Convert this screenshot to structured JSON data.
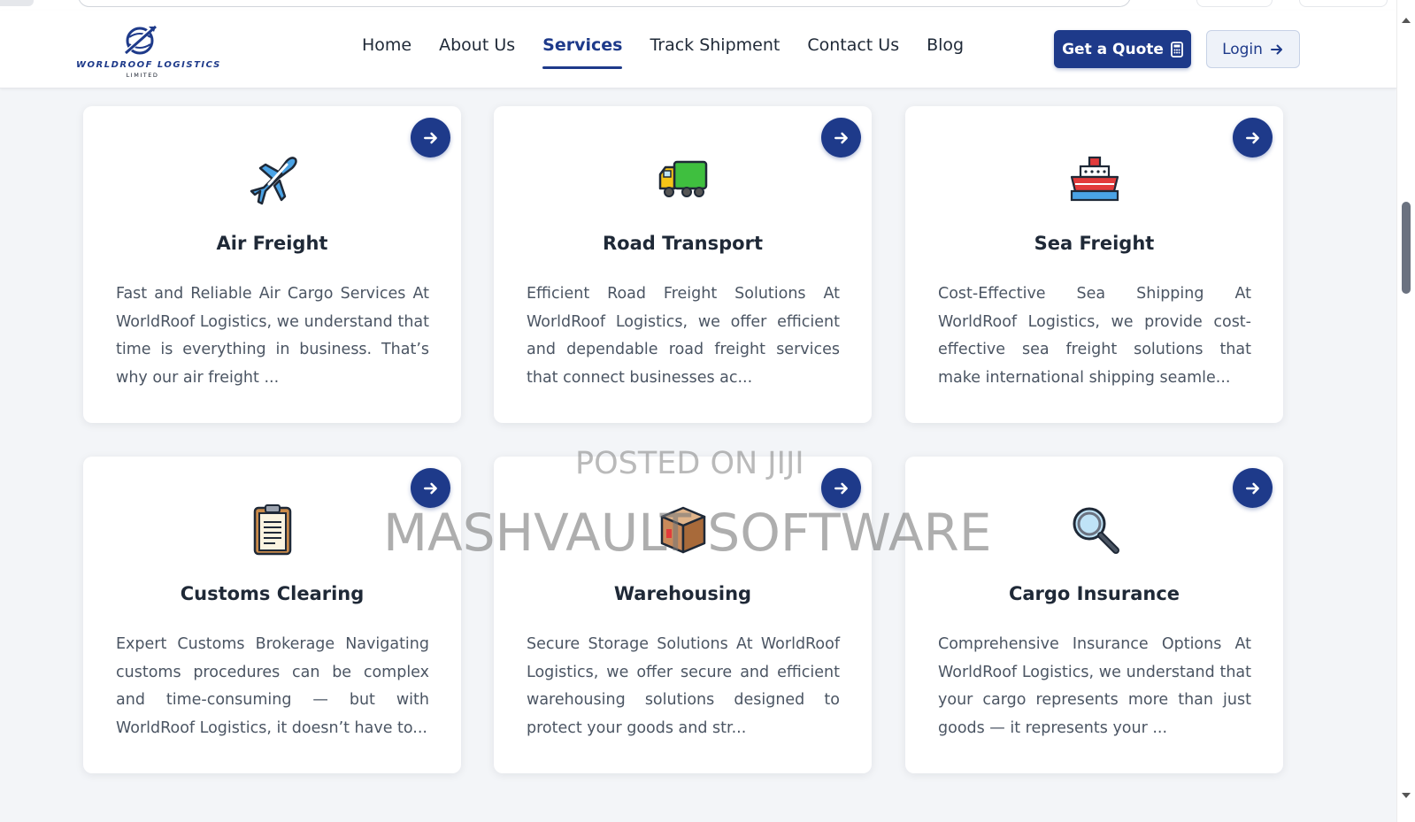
{
  "brand": {
    "name": "WORLDROOF LOGISTICS",
    "sub": "LIMITED"
  },
  "nav": {
    "links": [
      "Home",
      "About Us",
      "Services",
      "Track Shipment",
      "Contact Us",
      "Blog"
    ],
    "active": "Services",
    "quote_label": "Get a Quote",
    "login_label": "Login"
  },
  "services": [
    {
      "title": "Air Freight",
      "icon": "airplane-icon",
      "desc": "Fast and Reliable Air Cargo Services At WorldRoof Logistics, we understand that time is everything in business. That’s why our air freight ..."
    },
    {
      "title": "Road Transport",
      "icon": "truck-icon",
      "desc": "Efficient Road Freight Solutions At WorldRoof Logistics, we offer efficient and dependable road freight services that connect businesses ac..."
    },
    {
      "title": "Sea Freight",
      "icon": "ship-icon",
      "desc": "Cost-Effective Sea Shipping At WorldRoof Logistics, we provide cost-effective sea freight solutions that make international shipping seamle..."
    },
    {
      "title": "Customs Clearing",
      "icon": "clipboard-icon",
      "desc": "Expert Customs Brokerage Navigating customs procedures can be complex and time-consuming — but with WorldRoof Logistics, it doesn’t have to..."
    },
    {
      "title": "Warehousing",
      "icon": "package-icon",
      "desc": "Secure Storage Solutions At WorldRoof Logistics, we offer secure and efficient warehousing solutions designed to protect your goods and str..."
    },
    {
      "title": "Cargo Insurance",
      "icon": "magnifier-icon",
      "desc": "Comprehensive Insurance Options At WorldRoof Logistics, we understand that your cargo represents more than just goods — it represents your ..."
    }
  ],
  "watermark": {
    "line1": "POSTED ON JIJI",
    "line2": "MASHVAULT SOFTWARE"
  },
  "colors": {
    "primary": "#1e3a8a",
    "background": "#f3f5f8"
  }
}
